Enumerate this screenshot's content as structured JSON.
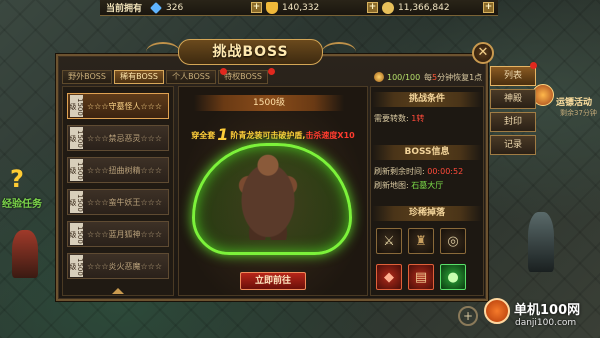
{
  "topbar": {
    "owned_label": "当前拥有",
    "resources": [
      {
        "icon": "diamond-icon",
        "value": "326",
        "color": "#5fb4ff"
      },
      {
        "icon": "gold-ingot-icon",
        "value": "140,332",
        "color": "#f0b93a"
      },
      {
        "icon": "coin-icon",
        "value": "11,366,842",
        "color": "#e8c05a"
      }
    ],
    "plus_label": "+"
  },
  "window": {
    "title": "挑战BOSS",
    "close_glyph": "✕"
  },
  "tabs": [
    {
      "label": "野外BOSS",
      "active": false
    },
    {
      "label": "稀有BOSS",
      "active": true
    },
    {
      "label": "个人BOSS",
      "active": false
    },
    {
      "label": "特权BOSS",
      "active": false
    }
  ],
  "boss_list": {
    "items": [
      {
        "badge": "1500级",
        "name": "☆☆☆守墓怪人☆☆☆",
        "active": true
      },
      {
        "badge": "1500级",
        "name": "☆☆☆禁忌恶灵☆☆☆",
        "active": false
      },
      {
        "badge": "1500级",
        "name": "☆☆☆扭曲树精☆☆☆",
        "active": false
      },
      {
        "badge": "1500级",
        "name": "☆☆☆蛮牛妖王☆☆☆",
        "active": false
      },
      {
        "badge": "1500级",
        "name": "☆☆☆蓝月狐神☆☆☆",
        "active": false
      },
      {
        "badge": "1500级",
        "name": "☆☆☆炎火恶魔☆☆☆",
        "active": false
      }
    ]
  },
  "boss_view": {
    "level": "1500级",
    "promo_prefix": "穿全套",
    "promo_num": "1",
    "promo_mid": "阶青龙装可击破护盾,",
    "promo_suffix": "击杀速度X10",
    "go_button": "立即前往"
  },
  "stamina": {
    "value": "100/100",
    "recover_prefix": "每",
    "recover_num": "5",
    "recover_suffix": "分钟恢复1点"
  },
  "info": {
    "challenge_title": "挑战条件",
    "req_label": "需要转数:",
    "req_value": "1转",
    "boss_info_title": "BOSS信息",
    "refresh_time_label": "刷新剩余时间:",
    "refresh_time_value": "00:00:52",
    "refresh_map_label": "刷新地图:",
    "refresh_map_value": "石墓大厅",
    "drops_title": "珍稀掉落",
    "drops": [
      {
        "icon": "sword-icon",
        "label": "",
        "style": ""
      },
      {
        "icon": "armor-icon",
        "label": "",
        "style": ""
      },
      {
        "icon": "ring-icon",
        "label": "",
        "style": ""
      },
      {
        "icon": "red-gem-icon",
        "label": "",
        "style": "red"
      },
      {
        "icon": "book-icon",
        "label": "",
        "style": "red"
      },
      {
        "icon": "green-orb-icon",
        "label": "",
        "style": "green"
      }
    ]
  },
  "side_buttons": [
    {
      "label": "列表",
      "active": true
    },
    {
      "label": "神殿",
      "active": false
    },
    {
      "label": "封印",
      "active": false
    },
    {
      "label": "记录",
      "active": false
    }
  ],
  "hud": {
    "quest_label": "经验任务",
    "event_label": "运镖活动",
    "event_sub": "剩余37分钟"
  },
  "watermark": {
    "brand": "单机100网",
    "url": "danji100.com"
  }
}
